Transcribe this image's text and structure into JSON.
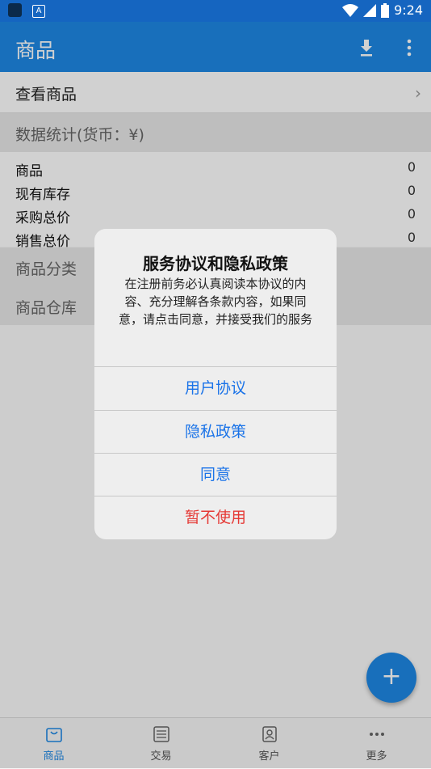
{
  "status_bar": {
    "time": "9:24"
  },
  "app_bar": {
    "title": "商品"
  },
  "view_products": {
    "label": "查看商品",
    "chevron": "›"
  },
  "stats_section": {
    "title": "数据统计(货币：¥)"
  },
  "stats": [
    {
      "label": "商品",
      "value": "0"
    },
    {
      "label": "现有库存",
      "value": "0"
    },
    {
      "label": "采购总价",
      "value": "0"
    },
    {
      "label": "销售总价",
      "value": "0"
    }
  ],
  "sections": {
    "category": "商品分类",
    "warehouse": "商品仓库"
  },
  "dialog": {
    "title": "服务协议和隐私政策",
    "message": "在注册前务必认真阅读本协议的内容、充分理解各条款内容，如果同意，请点击同意，并接受我们的服务",
    "buttons": {
      "user_agreement": "用户协议",
      "privacy_policy": "隐私政策",
      "agree": "同意",
      "decline": "暂不使用"
    }
  },
  "fab": {
    "icon": "plus-icon",
    "symbol": "+"
  },
  "bottom_nav": [
    {
      "label": "商品",
      "icon": "bag-icon"
    },
    {
      "label": "交易",
      "icon": "receipt-icon"
    },
    {
      "label": "客户",
      "icon": "contact-card-icon"
    },
    {
      "label": "更多",
      "icon": "more-dots-icon"
    }
  ],
  "colors": {
    "primary": "#1e88e5",
    "status_bar": "#1565c0",
    "danger": "#e53935",
    "link": "#1a73e8"
  }
}
